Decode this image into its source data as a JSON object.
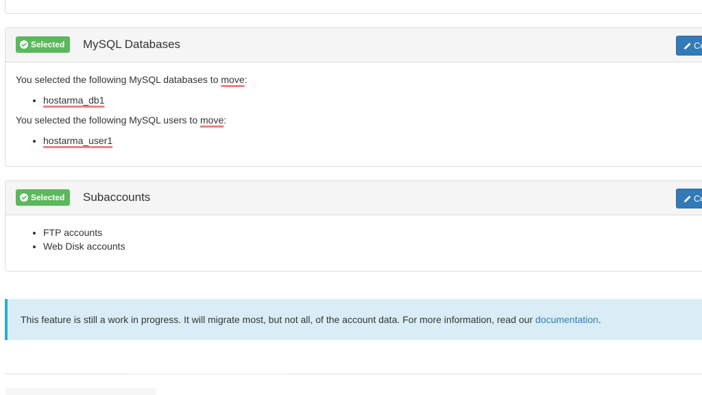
{
  "mysql_section": {
    "badge": "Selected",
    "title": "MySQL Databases",
    "button_label": "Co",
    "db_intro_prefix": "You selected the following MySQL databases to ",
    "db_intro_word": "move",
    "db_intro_suffix": ":",
    "databases": [
      "hostarma_db1"
    ],
    "user_intro_prefix": "You selected the following MySQL users to ",
    "user_intro_word": "move",
    "user_intro_suffix": ":",
    "users": [
      "hostarma_user1"
    ]
  },
  "subaccounts_section": {
    "badge": "Selected",
    "title": "Subaccounts",
    "button_label": "Co",
    "items": [
      "FTP accounts",
      "Web Disk accounts"
    ]
  },
  "notice": {
    "text": "This feature is still a work in progress. It will migrate most, but not all, of the account data. For more information, read our ",
    "link_text": "documentation",
    "suffix": "."
  },
  "colors": {
    "badge_green": "#5cb85c",
    "button_blue": "#337ab7",
    "info_bg": "#d9edf7",
    "spellcheck_red": "#f08080"
  }
}
